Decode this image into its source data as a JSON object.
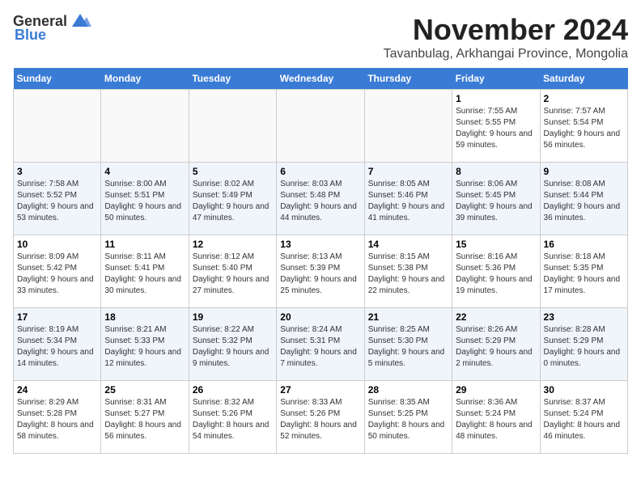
{
  "logo": {
    "general": "General",
    "blue": "Blue"
  },
  "title": {
    "month": "November 2024",
    "location": "Tavanbulag, Arkhangai Province, Mongolia"
  },
  "weekdays": [
    "Sunday",
    "Monday",
    "Tuesday",
    "Wednesday",
    "Thursday",
    "Friday",
    "Saturday"
  ],
  "weeks": [
    [
      {
        "day": "",
        "info": ""
      },
      {
        "day": "",
        "info": ""
      },
      {
        "day": "",
        "info": ""
      },
      {
        "day": "",
        "info": ""
      },
      {
        "day": "",
        "info": ""
      },
      {
        "day": "1",
        "info": "Sunrise: 7:55 AM\nSunset: 5:55 PM\nDaylight: 9 hours and 59 minutes."
      },
      {
        "day": "2",
        "info": "Sunrise: 7:57 AM\nSunset: 5:54 PM\nDaylight: 9 hours and 56 minutes."
      }
    ],
    [
      {
        "day": "3",
        "info": "Sunrise: 7:58 AM\nSunset: 5:52 PM\nDaylight: 9 hours and 53 minutes."
      },
      {
        "day": "4",
        "info": "Sunrise: 8:00 AM\nSunset: 5:51 PM\nDaylight: 9 hours and 50 minutes."
      },
      {
        "day": "5",
        "info": "Sunrise: 8:02 AM\nSunset: 5:49 PM\nDaylight: 9 hours and 47 minutes."
      },
      {
        "day": "6",
        "info": "Sunrise: 8:03 AM\nSunset: 5:48 PM\nDaylight: 9 hours and 44 minutes."
      },
      {
        "day": "7",
        "info": "Sunrise: 8:05 AM\nSunset: 5:46 PM\nDaylight: 9 hours and 41 minutes."
      },
      {
        "day": "8",
        "info": "Sunrise: 8:06 AM\nSunset: 5:45 PM\nDaylight: 9 hours and 39 minutes."
      },
      {
        "day": "9",
        "info": "Sunrise: 8:08 AM\nSunset: 5:44 PM\nDaylight: 9 hours and 36 minutes."
      }
    ],
    [
      {
        "day": "10",
        "info": "Sunrise: 8:09 AM\nSunset: 5:42 PM\nDaylight: 9 hours and 33 minutes."
      },
      {
        "day": "11",
        "info": "Sunrise: 8:11 AM\nSunset: 5:41 PM\nDaylight: 9 hours and 30 minutes."
      },
      {
        "day": "12",
        "info": "Sunrise: 8:12 AM\nSunset: 5:40 PM\nDaylight: 9 hours and 27 minutes."
      },
      {
        "day": "13",
        "info": "Sunrise: 8:13 AM\nSunset: 5:39 PM\nDaylight: 9 hours and 25 minutes."
      },
      {
        "day": "14",
        "info": "Sunrise: 8:15 AM\nSunset: 5:38 PM\nDaylight: 9 hours and 22 minutes."
      },
      {
        "day": "15",
        "info": "Sunrise: 8:16 AM\nSunset: 5:36 PM\nDaylight: 9 hours and 19 minutes."
      },
      {
        "day": "16",
        "info": "Sunrise: 8:18 AM\nSunset: 5:35 PM\nDaylight: 9 hours and 17 minutes."
      }
    ],
    [
      {
        "day": "17",
        "info": "Sunrise: 8:19 AM\nSunset: 5:34 PM\nDaylight: 9 hours and 14 minutes."
      },
      {
        "day": "18",
        "info": "Sunrise: 8:21 AM\nSunset: 5:33 PM\nDaylight: 9 hours and 12 minutes."
      },
      {
        "day": "19",
        "info": "Sunrise: 8:22 AM\nSunset: 5:32 PM\nDaylight: 9 hours and 9 minutes."
      },
      {
        "day": "20",
        "info": "Sunrise: 8:24 AM\nSunset: 5:31 PM\nDaylight: 9 hours and 7 minutes."
      },
      {
        "day": "21",
        "info": "Sunrise: 8:25 AM\nSunset: 5:30 PM\nDaylight: 9 hours and 5 minutes."
      },
      {
        "day": "22",
        "info": "Sunrise: 8:26 AM\nSunset: 5:29 PM\nDaylight: 9 hours and 2 minutes."
      },
      {
        "day": "23",
        "info": "Sunrise: 8:28 AM\nSunset: 5:29 PM\nDaylight: 9 hours and 0 minutes."
      }
    ],
    [
      {
        "day": "24",
        "info": "Sunrise: 8:29 AM\nSunset: 5:28 PM\nDaylight: 8 hours and 58 minutes."
      },
      {
        "day": "25",
        "info": "Sunrise: 8:31 AM\nSunset: 5:27 PM\nDaylight: 8 hours and 56 minutes."
      },
      {
        "day": "26",
        "info": "Sunrise: 8:32 AM\nSunset: 5:26 PM\nDaylight: 8 hours and 54 minutes."
      },
      {
        "day": "27",
        "info": "Sunrise: 8:33 AM\nSunset: 5:26 PM\nDaylight: 8 hours and 52 minutes."
      },
      {
        "day": "28",
        "info": "Sunrise: 8:35 AM\nSunset: 5:25 PM\nDaylight: 8 hours and 50 minutes."
      },
      {
        "day": "29",
        "info": "Sunrise: 8:36 AM\nSunset: 5:24 PM\nDaylight: 8 hours and 48 minutes."
      },
      {
        "day": "30",
        "info": "Sunrise: 8:37 AM\nSunset: 5:24 PM\nDaylight: 8 hours and 46 minutes."
      }
    ]
  ]
}
